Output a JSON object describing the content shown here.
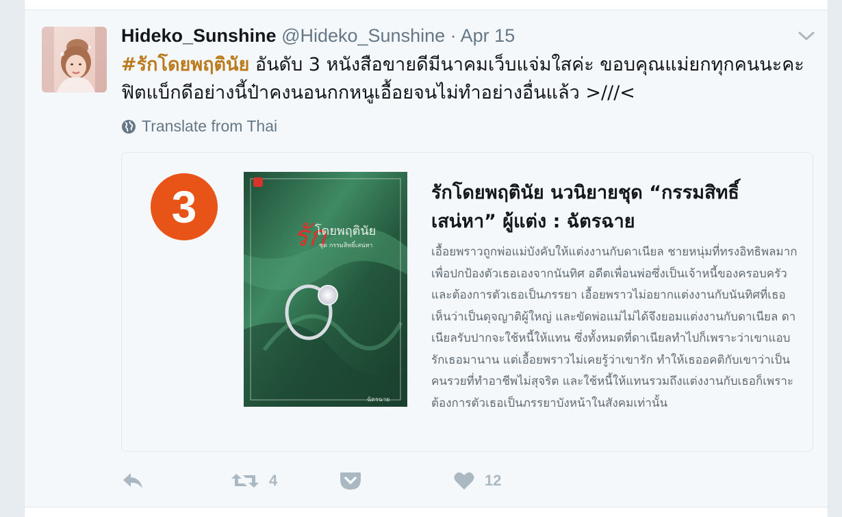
{
  "tweet": {
    "fullname": "Hideko_Sunshine",
    "username": "@Hideko_Sunshine",
    "separator": "·",
    "timestamp": "Apr 15",
    "hashtag": "#รักโดยพฤตินัย",
    "text_line1": " อันดับ 3 หนังสือขายดีมีนาคมเว็บแจ่มใสค่ะ ขอบคุณแม่ยกทุกคนนะคะ",
    "text_line2": "ฟิตแบ็กดีอย่างนี้ป๋าคงนอนกกหนูเอื้อยจนไม่ทำอย่างอื่นแล้ว >///<",
    "translate_label": "Translate from Thai"
  },
  "card": {
    "rank": "3",
    "cover_title": "รัก",
    "cover_subtitle": "โดยพฤตินัย",
    "cover_series": "ชุด กรรมสิทธิ์เสน่หา",
    "cover_author": "ฉัตรฉาย",
    "title": "รักโดยพฤตินัย นวนิยายชุด “กรรมสิทธิ์เสน่หา” ผู้แต่ง : ฉัตรฉาย",
    "description": "เอื้อยพราวถูกพ่อแม่บังคับให้แต่งงานกับดาเนียล ชายหนุ่มที่ทรงอิทธิพลมาก เพื่อปกป้องตัวเธอเองจากนันทิศ อดีตเพื่อนพ่อซึ่งเป็นเจ้าหนี้ของครอบครัว และต้องการตัวเธอเป็นภรรยา เอื้อยพราวไม่อยากแต่งงานกับนันทิศที่เธอเห็นว่าเป็นดุจญาติผู้ใหญ่ และขัดพ่อแม่ไม่ได้จึงยอมแต่งงานกับดาเนียล ดาเนียลรับปากจะใช้หนี้ให้แทน ซึ่งทั้งหมดที่ดาเนียลทำไปก็เพราะว่าเขาแอบรักเธอมานาน แต่เอื้อยพราวไม่เคยรู้ว่าเขารัก ทำให้เธออคติกับเขาว่าเป็นคนรวยที่ทำอาชีพไม่สุจริต และใช้หนี้ให้แทนรวมถึงแต่งงานกับเธอก็เพราะต้องการตัวเธอเป็นภรรยาบังหน้าในสังคมเท่านั้น"
  },
  "actions": {
    "reply_icon": "reply-icon",
    "retweet_count": "4",
    "like_count": "12"
  },
  "colors": {
    "hashtag": "#bb7a1b",
    "rank_badge": "#e85417",
    "action_gray": "#aab8c2",
    "cover_green": "#2f6b4f"
  }
}
